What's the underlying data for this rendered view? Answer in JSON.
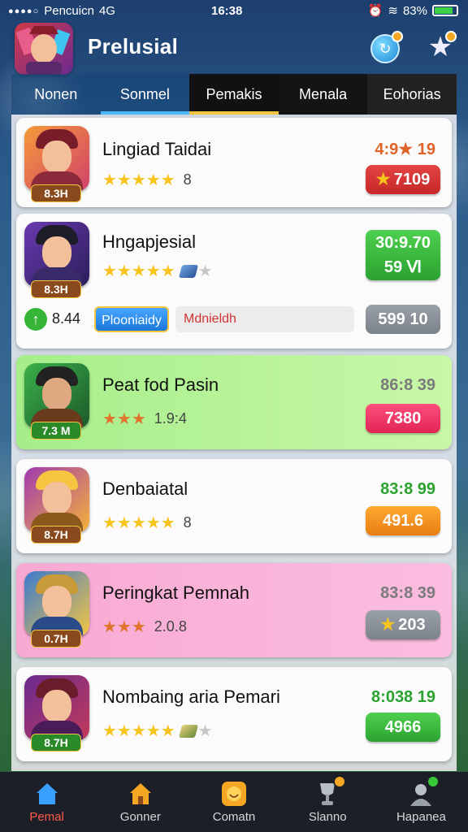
{
  "status_bar": {
    "carrier": "Pencuicn",
    "network": "4G",
    "time": "16:38",
    "battery": "83%",
    "battery_level": 0.83
  },
  "header": {
    "title": "Prelusial"
  },
  "tabs": [
    {
      "label": "Nonen"
    },
    {
      "label": "Sonmel"
    },
    {
      "label": "Pemakis"
    },
    {
      "label": "Menala"
    },
    {
      "label": "Eohorias"
    }
  ],
  "cards": [
    {
      "title": "Lingiad Taidai",
      "level": "8.3H",
      "stars_count": "8",
      "rating": "4:9★ 19",
      "pill": "7109"
    },
    {
      "title": "Hngapjesial",
      "level": "8.3H",
      "pill_line1": "30:9.70",
      "pill_line2": "59 Ⅵ",
      "extra_value": "8.44",
      "extra_button": "Plooniaidy",
      "extra_field": "Mdnieldh",
      "extra_gray": "599 10"
    },
    {
      "title": "Peat fod Pasin",
      "level": "7.3 M",
      "stars_count": "1.9:4",
      "rating": "86:8 39",
      "pill": "7380"
    },
    {
      "title": "Denbaiatal",
      "level": "8.7H",
      "stars_count": "8",
      "rating": "83:8 99",
      "pill": "491.6"
    },
    {
      "title": "Peringkat Pemnah",
      "level": "0.7H",
      "stars_count": "2.0.8",
      "rating": "83:8 39",
      "pill": "203"
    },
    {
      "title": "Nombaing aria Pemari",
      "level": "8.7H",
      "rating": "8:038 19",
      "pill": "4966"
    }
  ],
  "bottom_nav": [
    {
      "label": "Pemal"
    },
    {
      "label": "Gonner"
    },
    {
      "label": "Comatn"
    },
    {
      "label": "Slanno"
    },
    {
      "label": "Hapanea"
    }
  ],
  "colors": {
    "accent_red": "#c62727",
    "accent_green": "#2aa22f",
    "star": "#f7c41b",
    "nav_bg": "#1c1f27",
    "nav_active": "#ff5a4a"
  }
}
